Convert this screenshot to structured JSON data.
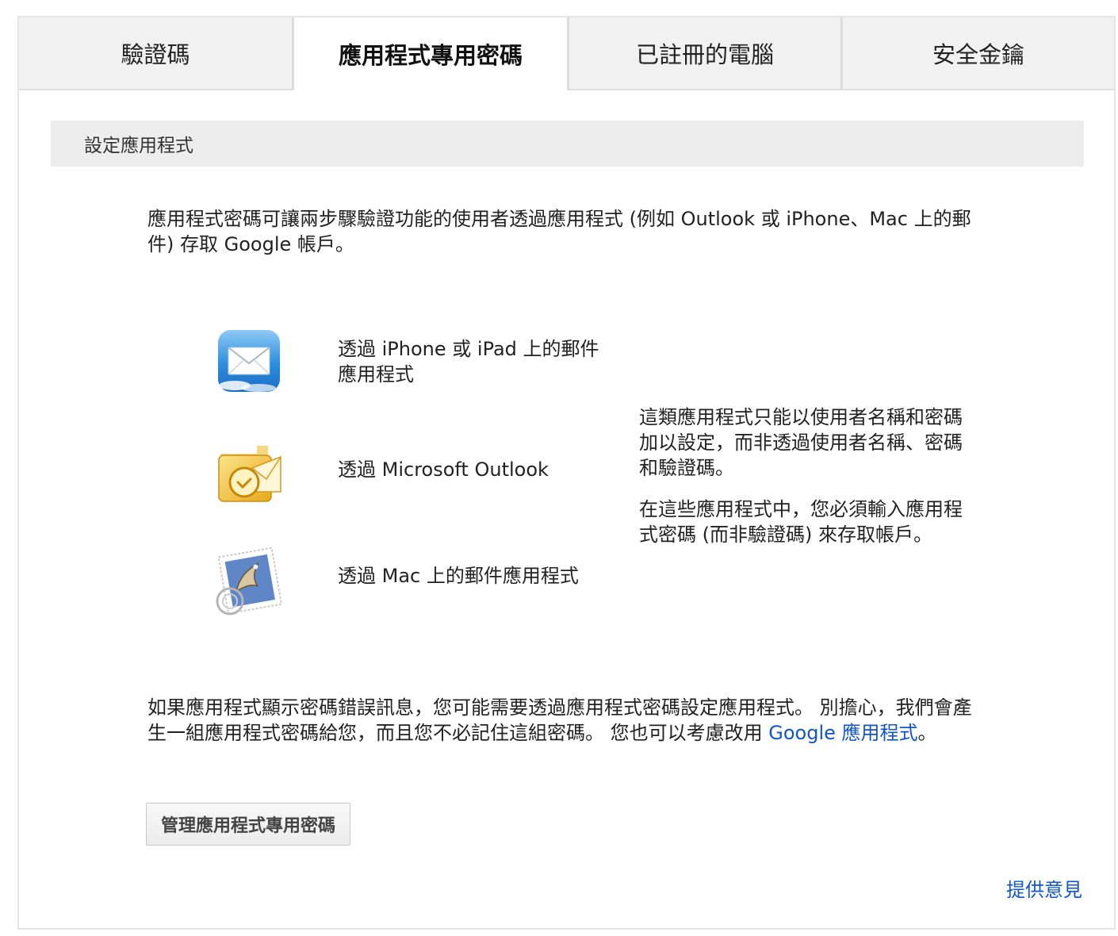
{
  "tabs": [
    {
      "label": "驗證碼",
      "active": false
    },
    {
      "label": "應用程式專用密碼",
      "active": true
    },
    {
      "label": "已註冊的電腦",
      "active": false
    },
    {
      "label": "安全金鑰",
      "active": false
    }
  ],
  "section_title": "設定應用程式",
  "intro": "應用程式密碼可讓兩步驟驗證功能的使用者透過應用程式 (例如 Outlook 或 iPhone、Mac 上的郵件) 存取 Google 帳戶。",
  "apps": [
    {
      "icon": "ios-mail-icon",
      "label": "透過 iPhone 或 iPad 上的郵件應用程式"
    },
    {
      "icon": "outlook-icon",
      "label": "透過 Microsoft Outlook"
    },
    {
      "icon": "mac-mail-icon",
      "label": "透過 Mac 上的郵件應用程式"
    }
  ],
  "note": {
    "p1": "這類應用程式只能以使用者名稱和密碼加以設定，而非透過使用者名稱、密碼和驗證碼。",
    "p2": "在這些應用程式中，您必須輸入應用程式密碼 (而非驗證碼) 來存取帳戶。"
  },
  "bottom": {
    "text": "如果應用程式顯示密碼錯誤訊息，您可能需要透過應用程式密碼設定應用程式。 別擔心，我們會產生一組應用程式密碼給您，而且您不必記住這組密碼。 您也可以考慮改用 ",
    "link": "Google 應用程式",
    "end": "。"
  },
  "manage_button": "管理應用程式專用密碼",
  "feedback_link": "提供意見",
  "colors": {
    "link": "#1155cc",
    "tab_inactive": "#f1f1f1",
    "section_bar": "#ededed"
  }
}
